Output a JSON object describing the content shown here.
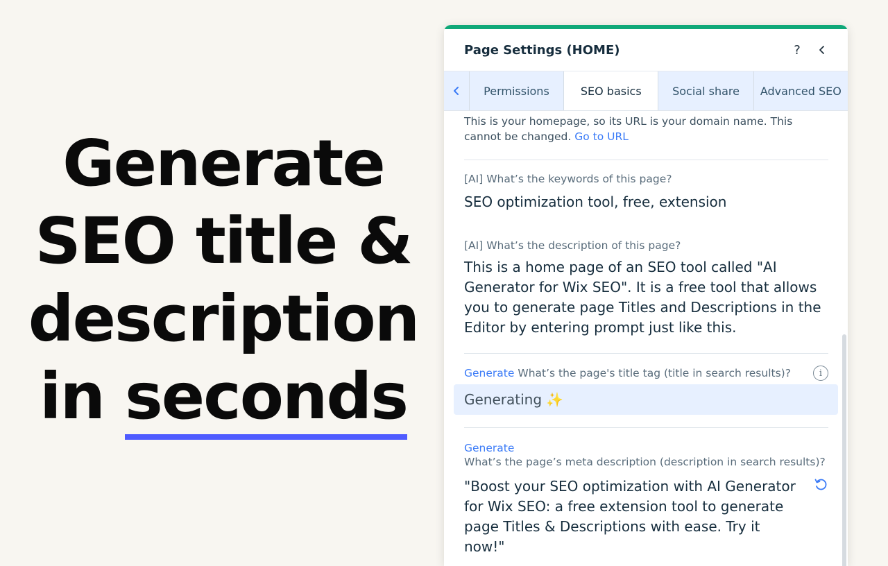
{
  "headline": {
    "line1": "Generate",
    "line2": "SEO title &",
    "line3": "description",
    "line4_prefix": "in ",
    "line4_emphasis": "seconds"
  },
  "panel": {
    "title": "Page Settings (HOME)",
    "help_label": "?",
    "tabs": [
      "Permissions",
      "SEO basics",
      "Social share",
      "Advanced SEO"
    ],
    "active_tab": "SEO basics",
    "url_note": "This is your homepage, so its URL is your domain name. This cannot be changed.",
    "url_link": "Go to URL",
    "keywords_question": "[AI] What’s the keywords of this page?",
    "keywords_answer": "SEO optimization tool, free, extension",
    "description_question": "[AI] What’s the description of this page?",
    "description_answer": "This is a home page of an SEO tool called \"AI Generator for Wix SEO\". It is a free tool that allows you to generate page Titles and Descriptions in the Editor by entering prompt just like this.",
    "title_generate_link": "Generate",
    "title_question": "What’s the page's title tag (title in search results)?",
    "generating_text": "Generating ✨",
    "meta_generate_link": "Generate",
    "meta_question": "What’s the page’s meta description (description in search results)?",
    "meta_answer": "\"Boost your SEO optimization with AI Generator for Wix SEO: a free extension tool to generate page Titles & Descriptions with ease. Try it now!\""
  },
  "colors": {
    "accent_bar": "#0fa878",
    "link": "#3b7bf7",
    "underline": "#4f5bff",
    "tab_bg": "#e7f0ff"
  }
}
